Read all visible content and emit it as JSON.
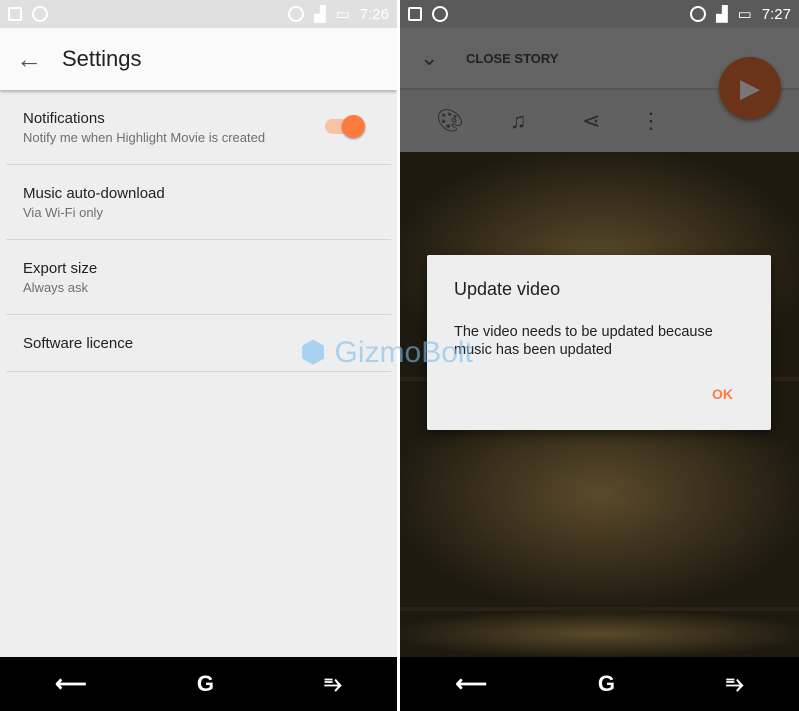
{
  "left": {
    "status": {
      "time": "7:26"
    },
    "toolbar": {
      "back_icon": "arrow-left-icon",
      "title": "Settings"
    },
    "items": [
      {
        "title": "Notifications",
        "subtitle": "Notify me when Highlight Movie is created",
        "toggle_on": true
      },
      {
        "title": "Music auto-download",
        "subtitle": "Via Wi-Fi only"
      },
      {
        "title": "Export size",
        "subtitle": "Always ask"
      },
      {
        "title": "Software licence"
      }
    ],
    "accent": "#ff7a3d"
  },
  "right": {
    "status": {
      "time": "7:27"
    },
    "toolbar": {
      "close_label": "CLOSE STORY"
    },
    "icons": [
      "palette-icon",
      "music-note-icon",
      "share-icon",
      "more-vert-icon",
      "play-icon"
    ],
    "dialog": {
      "title": "Update video",
      "message": "The video needs to be updated because music has been updated",
      "ok_label": "OK"
    }
  },
  "watermark": "GizmoBolt"
}
